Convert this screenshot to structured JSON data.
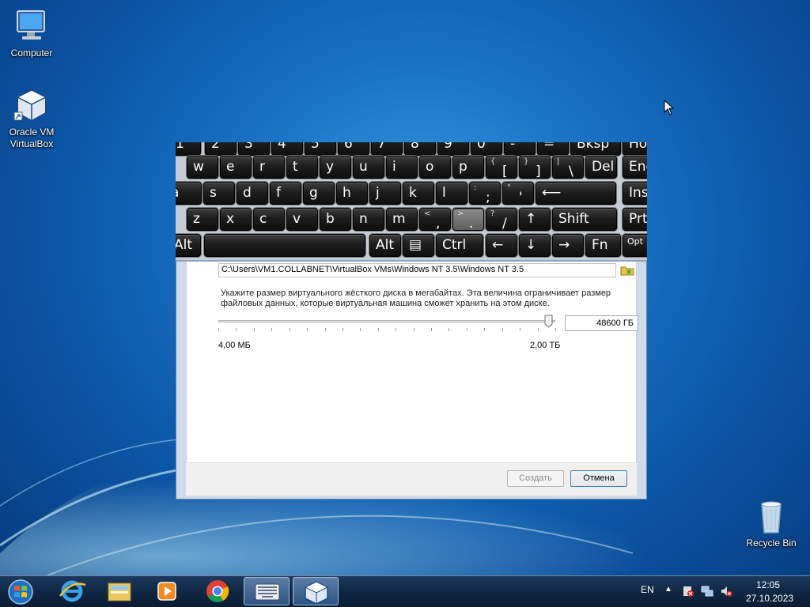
{
  "desktop": {
    "icons": [
      {
        "label_line1": "Computer",
        "label_line2": ""
      },
      {
        "label_line1": "Oracle VM",
        "label_line2": "VirtualBox"
      },
      {
        "label_line1": "Recycle Bin",
        "label_line2": ""
      }
    ]
  },
  "dialog": {
    "path_value": "C:\\Users\\VM1.COLLABNET\\VirtualBox VMs\\Windows NT 3.5\\Windows NT 3.5",
    "description": "Укажите размер виртуального жёсткого диска в мегабайтах. Эта величина ограничивает размер файловых данных, которые виртуальная машина сможет хранить на этом диске.",
    "size_value": "48600 ГБ",
    "range_min": "4,00 МБ",
    "range_max": "2,00 ТБ",
    "slider_fraction": 0.98,
    "create_label": "Создать",
    "cancel_label": "Отмена"
  },
  "keyboard": {
    "row1": [
      "1",
      "2",
      "3",
      "4",
      "5",
      "6",
      "7",
      "8",
      "9",
      "0",
      "-",
      "=",
      "Bksp",
      "Ho"
    ],
    "row2": [
      "w",
      "e",
      "r",
      "t",
      "y",
      "u",
      "i",
      "o",
      "p",
      "[",
      "]",
      "\\",
      "Del",
      "End"
    ],
    "row3": [
      "a",
      "s",
      "d",
      "f",
      "g",
      "h",
      "j",
      "k",
      "l",
      ";",
      "'",
      "⟵",
      "Inse"
    ],
    "row4": [
      "z",
      "x",
      "c",
      "v",
      "b",
      "n",
      "m",
      ",",
      ".",
      "/",
      "↑",
      "Shift",
      "PrtS"
    ],
    "row5": [
      "Alt",
      "",
      "Alt",
      "▤",
      "Ctrl",
      "←",
      "↓",
      "→",
      "Fn",
      "Opt"
    ],
    "row2_top": {
      "[": "{",
      "]": "}",
      "\\": "|"
    },
    "row3_top": {
      ";": ":",
      "'": "\""
    },
    "row4_top": {
      ",": "<",
      ".": ">",
      "/": "?"
    }
  },
  "taskbar": {
    "language": "EN",
    "time": "12:05",
    "date": "27.10.2023",
    "apps": [
      "start",
      "internet-explorer",
      "file-explorer",
      "media-player",
      "chrome",
      "on-screen-keyboard",
      "virtualbox"
    ],
    "active_apps": [
      "on-screen-keyboard",
      "virtualbox"
    ]
  },
  "colors": {
    "desktop_blue": "#1a74c8",
    "taskbar": "#0f2743",
    "key": "#1d1d1d"
  }
}
